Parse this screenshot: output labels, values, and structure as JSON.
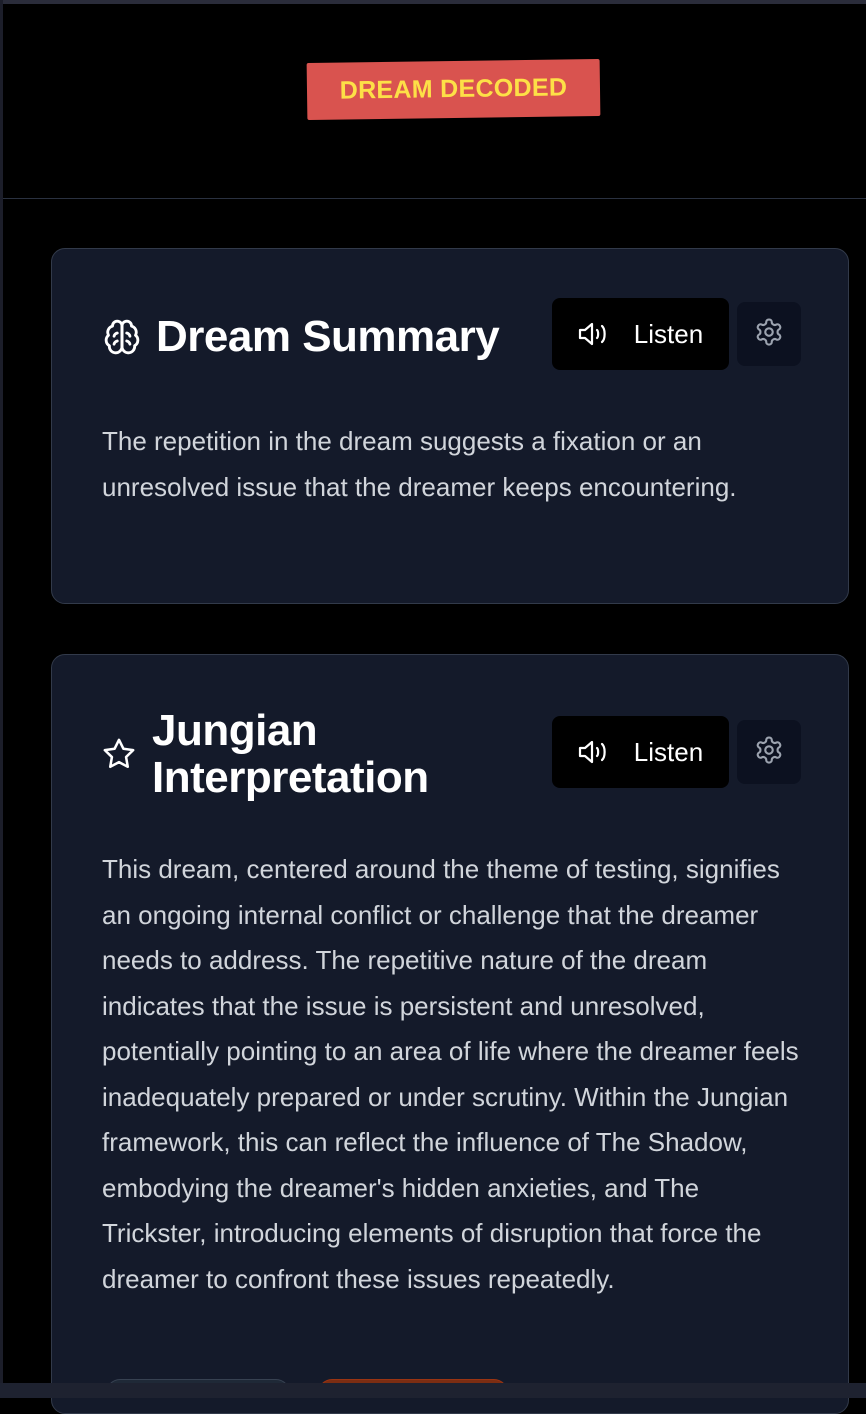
{
  "header": {
    "badge": "DREAM DECODED"
  },
  "cards": [
    {
      "title": "Dream Summary",
      "icon": "brain-icon",
      "listen_label": "Listen",
      "body": "The repetition in the dream suggests a fixation or an unresolved issue that the dreamer keeps encountering."
    },
    {
      "title_line1": "Jungian",
      "title_line2": "Interpretation",
      "icon": "star-icon",
      "listen_label": "Listen",
      "body": "This dream, centered around the theme of testing, signifies an ongoing internal conflict or challenge that the dreamer needs to address. The repetitive nature of the dream indicates that the issue is persistent and unresolved, potentially pointing to an area of life where the dreamer feels inadequately prepared or under scrutiny. Within the Jungian framework, this can reflect the influence of The Shadow, embodying the dreamer's hidden anxieties, and The Trickster, introducing elements of disruption that force the dreamer to confront these issues repeatedly."
    }
  ],
  "colors": {
    "badge_bg": "#d9534f",
    "badge_text": "#fde047",
    "card_bg": "#141a2a",
    "page_bg": "#000000"
  }
}
